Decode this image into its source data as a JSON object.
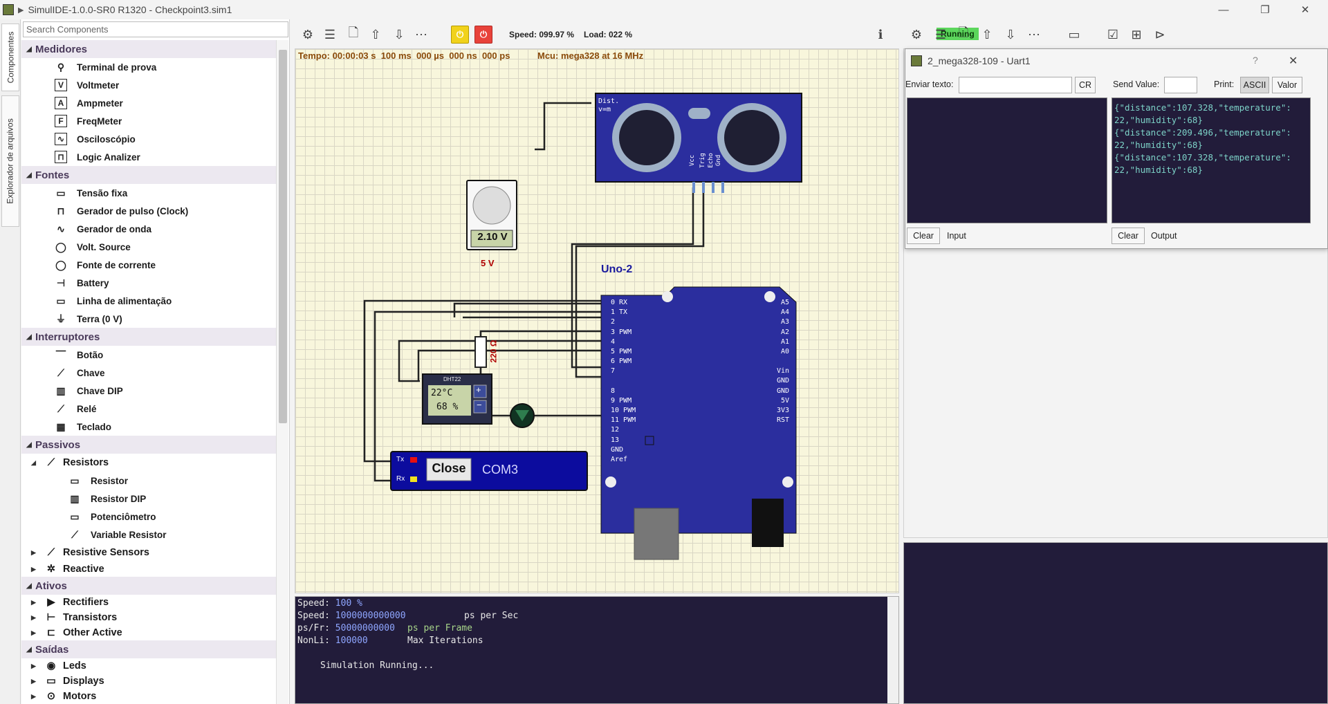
{
  "window": {
    "title": "SimulIDE-1.0.0-SR0 R1320 - Checkpoint3.sim1",
    "minimize": "—",
    "maximize": "❐",
    "close": "✕"
  },
  "vtabs": [
    "Componentes",
    "Explorador de arquivos"
  ],
  "search": {
    "placeholder": "Search Components"
  },
  "tree": {
    "medidores": {
      "label": "Medidores",
      "items": [
        {
          "label": "Terminal de prova",
          "icon": "⚲"
        },
        {
          "label": "Voltmeter",
          "icon": "V"
        },
        {
          "label": "Ampmeter",
          "icon": "A"
        },
        {
          "label": "FreqMeter",
          "icon": "F"
        },
        {
          "label": "Osciloscópio",
          "icon": "∿"
        },
        {
          "label": "Logic Analizer",
          "icon": "⊓"
        }
      ]
    },
    "fontes": {
      "label": "Fontes",
      "items": [
        {
          "label": "Tensão fixa",
          "icon": "▭"
        },
        {
          "label": "Gerador de pulso (Clock)",
          "icon": "⊓"
        },
        {
          "label": "Gerador de onda",
          "icon": "∿"
        },
        {
          "label": "Volt. Source",
          "icon": "◯"
        },
        {
          "label": "Fonte de corrente",
          "icon": "◯"
        },
        {
          "label": "Battery",
          "icon": "⊣"
        },
        {
          "label": "Linha de alimentação",
          "icon": "▭"
        },
        {
          "label": "Terra (0 V)",
          "icon": "⏚"
        }
      ]
    },
    "interruptores": {
      "label": "Interruptores",
      "items": [
        {
          "label": "Botão",
          "icon": "⎺"
        },
        {
          "label": "Chave",
          "icon": "⟋"
        },
        {
          "label": "Chave DIP",
          "icon": "▥"
        },
        {
          "label": "Relé",
          "icon": "⟋"
        },
        {
          "label": "Teclado",
          "icon": "▦"
        }
      ]
    },
    "passivos": {
      "label": "Passivos",
      "resistors": {
        "label": "Resistors",
        "icon": "⟋",
        "items": [
          {
            "label": "Resistor",
            "icon": "▭"
          },
          {
            "label": "Resistor DIP",
            "icon": "▥"
          },
          {
            "label": "Potenciômetro",
            "icon": "▭"
          },
          {
            "label": "Variable Resistor",
            "icon": "⟋"
          }
        ]
      },
      "subs": [
        {
          "label": "Resistive Sensors",
          "icon": "⟋"
        },
        {
          "label": "Reactive",
          "icon": "✲"
        }
      ]
    },
    "ativos": {
      "label": "Ativos",
      "subs": [
        {
          "label": "Rectifiers",
          "icon": "▶"
        },
        {
          "label": "Transistors",
          "icon": "⊢"
        },
        {
          "label": "Other Active",
          "icon": "⊏"
        }
      ]
    },
    "saidas": {
      "label": "Saídas",
      "subs": [
        {
          "label": "Leds",
          "icon": "◉"
        },
        {
          "label": "Displays",
          "icon": "▭"
        },
        {
          "label": "Motors",
          "icon": "⊙"
        }
      ]
    }
  },
  "toolbar": {
    "speed": "Speed: 099.97 %",
    "load": "Load: 022 %",
    "status": "Running"
  },
  "canvas": {
    "time": "Tempo: 00:00:03 s  100 ms  000 µs  000 ns  000 ps",
    "mcu": "Mcu: mega328 at 16 MHz",
    "sensor_label1": "Dist.",
    "sensor_label2": "v=m",
    "sensor_pins": [
      "Vcc",
      "Trig",
      "Echo",
      "Gnd"
    ],
    "pot_value": "2.10 V",
    "pot_caption": "5 V",
    "board_name": "Uno-2",
    "resistor_label": "220 Ω",
    "dht_name": "DHT22",
    "dht_temp": "22°C",
    "dht_hum": "68 %",
    "serial_tx": "Tx",
    "serial_rx": "Rx",
    "serial_close": "Close",
    "serial_port": "COM3",
    "board_left_pins": [
      "0 RX",
      "1 TX",
      "2",
      "3 PWM",
      "4",
      "5 PWM",
      "6 PWM",
      "7",
      "8",
      "9 PWM",
      "10 PWM",
      "11 PWM",
      "12",
      "13",
      "GND",
      "Aref"
    ],
    "board_right_pins": [
      "A5",
      "A4",
      "A3",
      "A2",
      "A1",
      "A0",
      "Vin",
      "GND",
      "GND",
      "5V",
      "3V3",
      "RST"
    ]
  },
  "console": {
    "l1k": "Speed:",
    "l1v": "100 %",
    "l2k": "Speed:",
    "l2v": "1000000000000",
    "l2d": "ps per Sec",
    "l3k": "ps/Fr:",
    "l3v": "50000000000",
    "l3d": "ps per Frame",
    "l4k": "NonLi:",
    "l4v": "100000",
    "l4d": "Max Iterations",
    "status": "Simulation Running..."
  },
  "uart": {
    "title": "2_mega328-109 - Uart1",
    "help": "?",
    "close": "✕",
    "send_text_label": "Enviar texto:",
    "cr_button": "CR",
    "send_value_label": "Send Value:",
    "print_label": "Print:",
    "ascii_button": "ASCII",
    "value_button": "Valor",
    "output_text": "{\"distance\":107.328,\"temperature\":\n22,\"humidity\":68}\n{\"distance\":209.496,\"temperature\":\n22,\"humidity\":68}\n{\"distance\":107.328,\"temperature\":\n22,\"humidity\":68}",
    "clear_input": "Clear",
    "input_label": "Input",
    "clear_output": "Clear",
    "output_label": "Output"
  }
}
